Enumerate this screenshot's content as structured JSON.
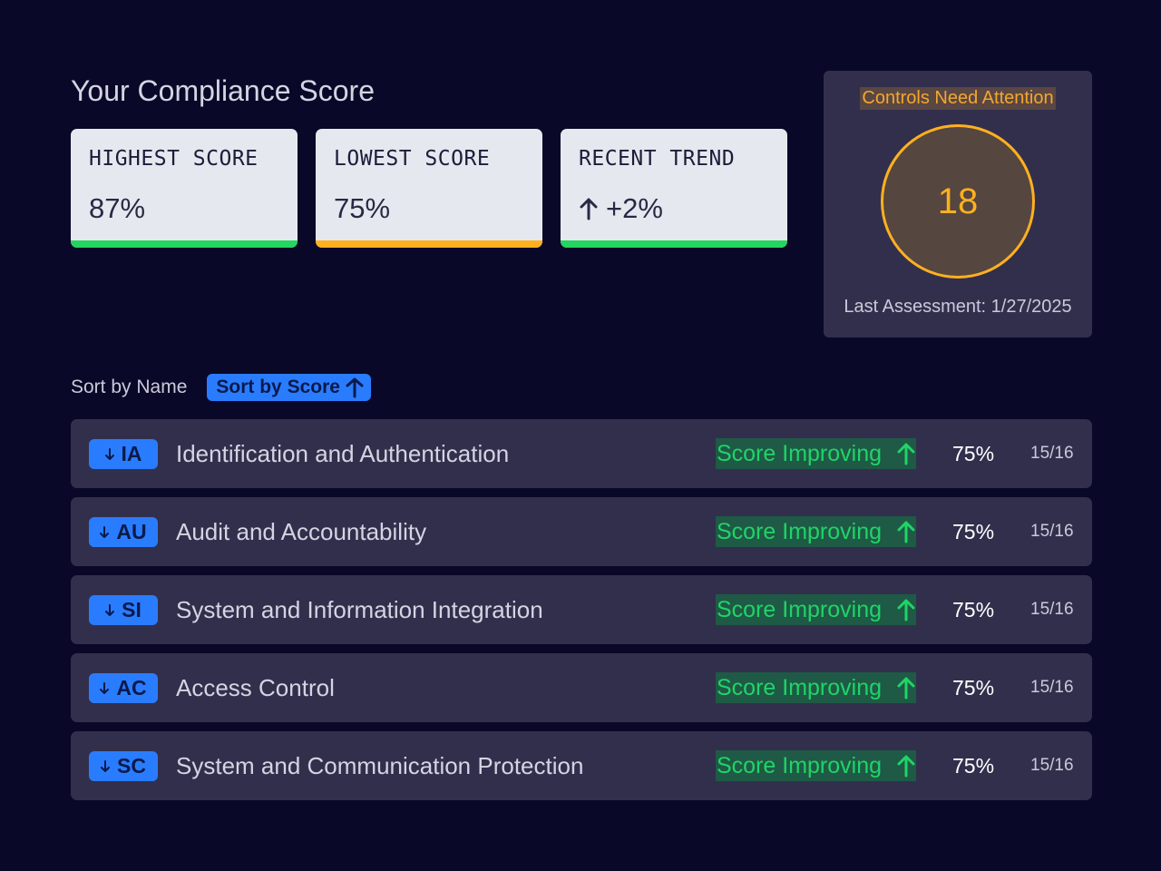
{
  "page": {
    "title": "Your Compliance Score"
  },
  "cards": [
    {
      "label": "HIGHEST SCORE",
      "value": "87%",
      "status_color": "#22d65f"
    },
    {
      "label": "LOWEST SCORE",
      "value": "75%",
      "status_color": "#ffb01f"
    },
    {
      "label": "RECENT TREND",
      "value": "+2%",
      "icon": "arrow-up-icon",
      "status_color": "#22d65f"
    }
  ],
  "attention": {
    "title": "Controls Need Attention",
    "count": "18",
    "last_assessment": "Last Assessment: 1/27/2025",
    "accent_color": "#ffb01f"
  },
  "sort": {
    "by_name_label": "Sort by Name",
    "by_score_label": "Sort by Score",
    "active": "score",
    "direction_icon": "arrow-up-icon"
  },
  "families": [
    {
      "code": "IA",
      "name": "Identification and Authentication",
      "trend": "Score Improving",
      "score": "75%",
      "count": "15/16"
    },
    {
      "code": "AU",
      "name": "Audit and Accountability",
      "trend": "Score Improving",
      "score": "75%",
      "count": "15/16"
    },
    {
      "code": "SI",
      "name": "System and Information Integration",
      "trend": "Score Improving",
      "score": "75%",
      "count": "15/16"
    },
    {
      "code": "AC",
      "name": "Access Control",
      "trend": "Score Improving",
      "score": "75%",
      "count": "15/16"
    },
    {
      "code": "SC",
      "name": "System and Communication Protection",
      "trend": "Score Improving",
      "score": "75%",
      "count": "15/16"
    }
  ],
  "colors": {
    "background": "#0a0828",
    "panel": "#322f4d",
    "accent_blue": "#2a7cff",
    "improving_green": "#20d468"
  }
}
